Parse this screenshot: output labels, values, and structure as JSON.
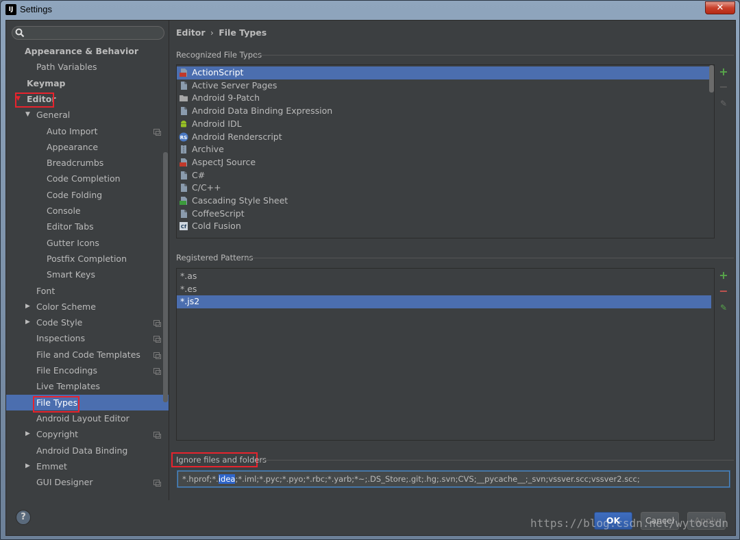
{
  "window": {
    "title": "Settings",
    "app_icon": "IJ",
    "close_label": "✕"
  },
  "sidebar": {
    "search_placeholder": "",
    "items": [
      {
        "label": "Appearance & Behavior",
        "level": 0,
        "bold": true,
        "arrow": ""
      },
      {
        "label": "Path Variables",
        "level": 1,
        "bold": false,
        "arrow": ""
      },
      {
        "label": "Keymap",
        "level": 0,
        "bold": true,
        "arrow": ""
      },
      {
        "label": "Editor",
        "level": 0,
        "bold": true,
        "arrow": "▼"
      },
      {
        "label": "General",
        "level": 1,
        "bold": false,
        "arrow": "▼"
      },
      {
        "label": "Auto Import",
        "level": 2,
        "bold": false,
        "arrow": "",
        "copy": true
      },
      {
        "label": "Appearance",
        "level": 2,
        "bold": false,
        "arrow": ""
      },
      {
        "label": "Breadcrumbs",
        "level": 2,
        "bold": false,
        "arrow": ""
      },
      {
        "label": "Code Completion",
        "level": 2,
        "bold": false,
        "arrow": ""
      },
      {
        "label": "Code Folding",
        "level": 2,
        "bold": false,
        "arrow": ""
      },
      {
        "label": "Console",
        "level": 2,
        "bold": false,
        "arrow": ""
      },
      {
        "label": "Editor Tabs",
        "level": 2,
        "bold": false,
        "arrow": ""
      },
      {
        "label": "Gutter Icons",
        "level": 2,
        "bold": false,
        "arrow": ""
      },
      {
        "label": "Postfix Completion",
        "level": 2,
        "bold": false,
        "arrow": ""
      },
      {
        "label": "Smart Keys",
        "level": 2,
        "bold": false,
        "arrow": ""
      },
      {
        "label": "Font",
        "level": 1,
        "bold": false,
        "arrow": ""
      },
      {
        "label": "Color Scheme",
        "level": 1,
        "bold": false,
        "arrow": "▶"
      },
      {
        "label": "Code Style",
        "level": 1,
        "bold": false,
        "arrow": "▶",
        "copy": true
      },
      {
        "label": "Inspections",
        "level": 1,
        "bold": false,
        "arrow": "",
        "copy": true
      },
      {
        "label": "File and Code Templates",
        "level": 1,
        "bold": false,
        "arrow": "",
        "copy": true
      },
      {
        "label": "File Encodings",
        "level": 1,
        "bold": false,
        "arrow": "",
        "copy": true
      },
      {
        "label": "Live Templates",
        "level": 1,
        "bold": false,
        "arrow": ""
      },
      {
        "label": "File Types",
        "level": 1,
        "bold": false,
        "arrow": "",
        "selected": true
      },
      {
        "label": "Android Layout Editor",
        "level": 1,
        "bold": false,
        "arrow": ""
      },
      {
        "label": "Copyright",
        "level": 1,
        "bold": false,
        "arrow": "▶",
        "copy": true
      },
      {
        "label": "Android Data Binding",
        "level": 1,
        "bold": false,
        "arrow": ""
      },
      {
        "label": "Emmet",
        "level": 1,
        "bold": false,
        "arrow": "▶"
      },
      {
        "label": "GUI Designer",
        "level": 1,
        "bold": false,
        "arrow": "",
        "copy": true
      }
    ]
  },
  "pane": {
    "breadcrumb_parent": "Editor",
    "breadcrumb_sep": "›",
    "breadcrumb_current": "File Types",
    "recognized_title": "Recognized File Types",
    "file_types": [
      {
        "name": "ActionScript",
        "icon": "actionscript-icon",
        "color": "#c0392b",
        "selected": true
      },
      {
        "name": "Active Server Pages",
        "icon": "file-icon",
        "color": "#8a9bad"
      },
      {
        "name": "Android 9-Patch",
        "icon": "folder-icon",
        "color": "#a8a8a8"
      },
      {
        "name": "Android Data Binding Expression",
        "icon": "file-icon",
        "color": "#8a9bad"
      },
      {
        "name": "Android IDL",
        "icon": "android-icon",
        "color": "#97c024"
      },
      {
        "name": "Android Renderscript",
        "icon": "renderscript-icon",
        "color": "#4a78c2"
      },
      {
        "name": "Archive",
        "icon": "archive-icon",
        "color": "#8a9bad"
      },
      {
        "name": "AspectJ Source",
        "icon": "aspectj-icon",
        "color": "#c0392b"
      },
      {
        "name": "C#",
        "icon": "file-icon",
        "color": "#8a9bad"
      },
      {
        "name": "C/C++",
        "icon": "file-icon",
        "color": "#8a9bad"
      },
      {
        "name": "Cascading Style Sheet",
        "icon": "css-icon",
        "color": "#3c9a3c"
      },
      {
        "name": "CoffeeScript",
        "icon": "file-icon",
        "color": "#8a9bad"
      },
      {
        "name": "Cold Fusion",
        "icon": "coldfusion-icon",
        "color": "#d0d8e0"
      }
    ],
    "patterns_title": "Registered Patterns",
    "patterns": [
      {
        "name": "*.as"
      },
      {
        "name": "*.es"
      },
      {
        "name": "*.js2",
        "selected": true
      }
    ],
    "ignore_title": "Ignore files and folders",
    "ignore_before": "*.hprof;*.",
    "ignore_highlight": "idea",
    "ignore_after": ";*.iml;*.pyc;*.pyo;*.rbc;*.yarb;*~;.DS_Store;.git;.hg;.svn;CVS;__pycache__;_svn;vssver.scc;vssver2.scc;"
  },
  "footer": {
    "help_label": "?",
    "ok_label": "OK",
    "cancel_label": "Cancel",
    "apply_label": "Apply",
    "watermark": "https://blog.csdn.net/wytocsdn"
  },
  "colors": {
    "accent": "#4b6eaf",
    "highlight_box": "#e8232d",
    "add": "#57a64a",
    "remove": "#c75450"
  }
}
